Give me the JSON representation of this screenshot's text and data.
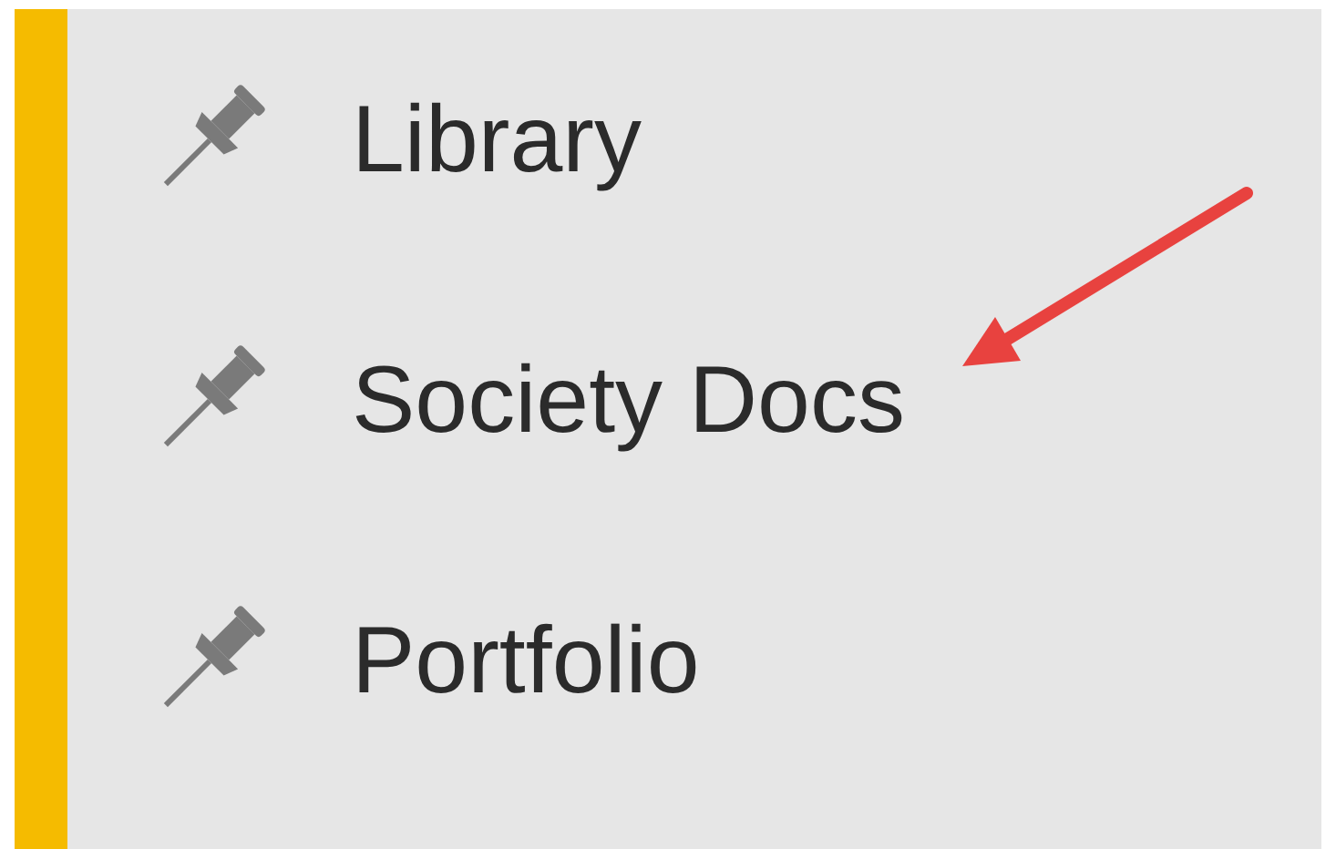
{
  "pinned_items": [
    {
      "label": "Library"
    },
    {
      "label": "Society Docs"
    },
    {
      "label": "Portfolio"
    }
  ]
}
